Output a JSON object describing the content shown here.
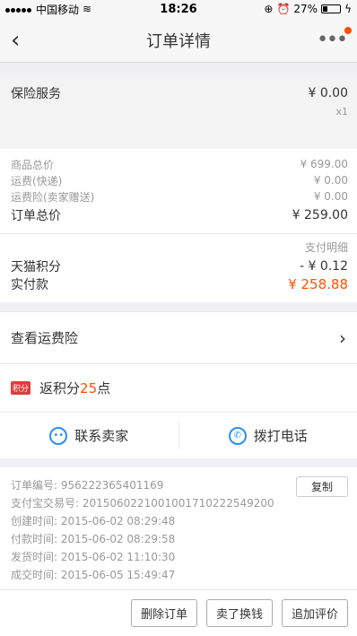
{
  "status": {
    "carrier": "中国移动",
    "time": "18:26",
    "battery": "27%"
  },
  "nav": {
    "title": "订单详情"
  },
  "insurance": {
    "name": "保险服务",
    "price": "¥ 0.00",
    "qty": "x1"
  },
  "costs": {
    "items": [
      {
        "label": "商品总价",
        "value": "¥ 699.00"
      },
      {
        "label": "运费(快递)",
        "value": "¥ 0.00"
      },
      {
        "label": "运费险(卖家赠送)",
        "value": "¥ 0.00"
      }
    ],
    "total_label": "订单总价",
    "total_value": "¥ 259.00"
  },
  "payment": {
    "detail_label": "支付明细",
    "tmall_label": "天猫积分",
    "tmall_value": "- ¥ 0.12",
    "actual_label": "实付款",
    "actual_value": "¥ 258.88"
  },
  "freight_insurance": {
    "label": "查看运费险"
  },
  "points": {
    "badge": "积分",
    "prefix": "返积分",
    "count": "25",
    "suffix": "点"
  },
  "contact": {
    "seller_label": "联系卖家",
    "call_label": "拨打电话"
  },
  "order_info": {
    "copy_label": "复制",
    "lines": [
      "订单编号:  956222365401169",
      "支付宝交易号:  2015060221001001710222549200",
      "创建时间:  2015-06-02 08:29:48",
      "付款时间:  2015-06-02 08:29:58",
      "发货时间:  2015-06-02 11:10:30",
      "成交时间:  2015-06-05 15:49:47"
    ]
  },
  "actions": {
    "delete": "删除订单",
    "resell": "卖了换钱",
    "review": "追加评价"
  }
}
